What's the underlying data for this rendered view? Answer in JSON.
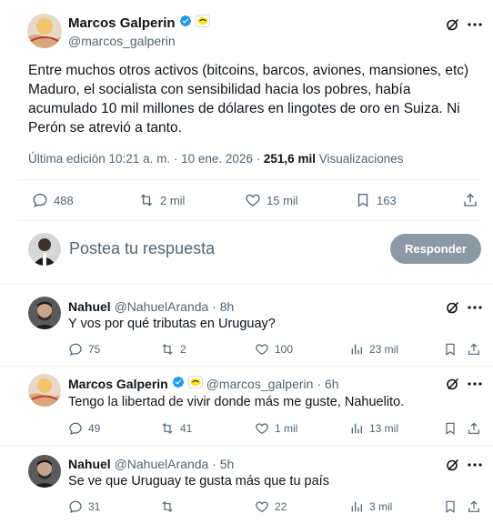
{
  "main_tweet": {
    "author_name": "Marcos Galperin",
    "author_handle": "@marcos_galperin",
    "text": "Entre muchos otros activos (bitcoins, barcos, aviones, mansiones, etc) Maduro, el socialista con sensibilidad hacia los pobres, había acumulado 10 mil millones de dólares en lingotes de oro en Suiza. Ni Perón se atrevió a tanto.",
    "meta_edit": "Última edición 10:21 a. m. · 10 ene. 2026 · ",
    "meta_views_count": "251,6 mil",
    "meta_views_label": " Visualizaciones",
    "stats": {
      "replies": "488",
      "reposts": "2 mil",
      "likes": "15 mil",
      "bookmarks": "163"
    }
  },
  "compose": {
    "placeholder": "Postea tu respuesta",
    "button": "Responder"
  },
  "replies": [
    {
      "name": "Nahuel",
      "handle": "@NahuelAranda",
      "time": "· 8h",
      "text": "Y vos por qué tributas en Uruguay?",
      "replies": "75",
      "reposts": "2",
      "likes": "100",
      "views": "23 mil"
    },
    {
      "name": "Marcos Galperin",
      "handle": "@marcos_galperin",
      "time": "· 6h",
      "text": "Tengo la libertad de vivir donde más me guste, Nahuelito.",
      "replies": "49",
      "reposts": "41",
      "likes": "1 mil",
      "views": "13 mil"
    },
    {
      "name": "Nahuel",
      "handle": "@NahuelAranda",
      "time": "· 5h",
      "text": "Se ve que Uruguay te gusta más que tu país",
      "replies": "31",
      "reposts": "",
      "likes": "22",
      "views": "3 mil"
    }
  ],
  "colors": {
    "verified": "#1d9bf0",
    "muted": "#536471",
    "button": "#8b98a5"
  }
}
